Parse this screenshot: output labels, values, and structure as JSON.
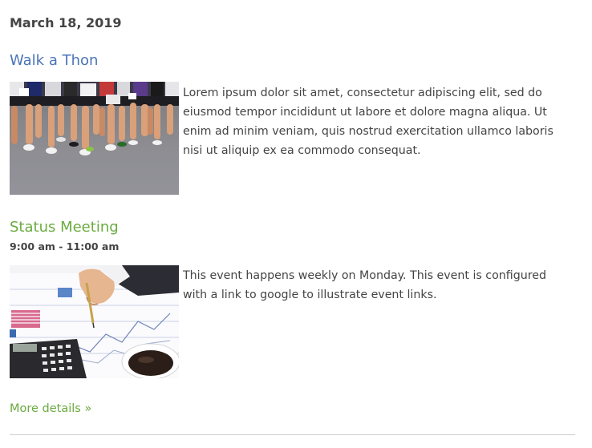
{
  "date_heading": "March 18, 2019",
  "events": [
    {
      "title": "Walk a Thon",
      "title_color": "#4a74b8",
      "image": "marathon-runners-photo",
      "description": "Lorem ipsum dolor sit amet, consectetur adipiscing elit, sed do eiusmod tempor incididunt ut labore et dolore magna aliqua. Ut enim ad minim veniam, quis nostrud exercitation ullamco laboris nisi ut aliquip ex ea commodo consequat."
    },
    {
      "title": "Status Meeting",
      "title_color": "#6aab3f",
      "time": "9:00 am - 11:00 am",
      "image": "business-paperwork-photo",
      "description": "This event happens weekly on Monday. This event is configured with a link to google to illustrate event links."
    }
  ],
  "more_details": "More details »"
}
